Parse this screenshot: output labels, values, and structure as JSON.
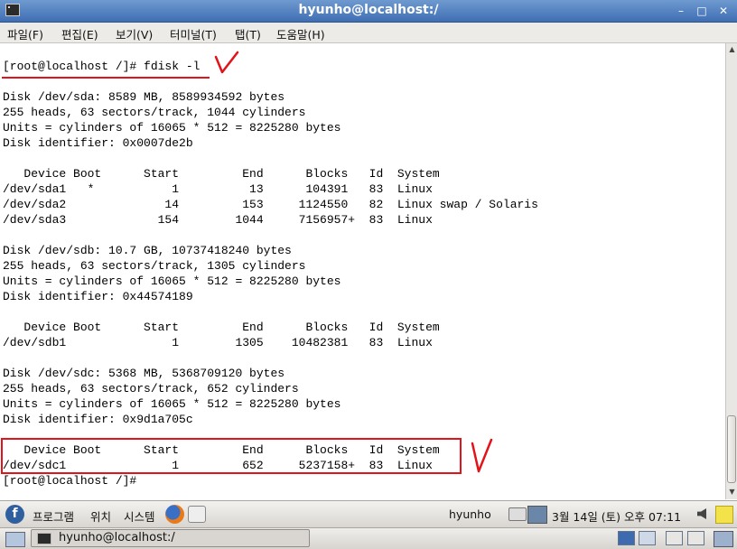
{
  "window": {
    "title": "hyunho@localhost:/",
    "minimize_glyph": "–",
    "maximize_glyph": "□",
    "close_glyph": "✕"
  },
  "menu": [
    "파일(F)",
    "편집(E)",
    "보기(V)",
    "터미널(T)",
    "탭(T)",
    "도움말(H)"
  ],
  "terminal_lines": [
    "[root@localhost /]# fdisk -l",
    "",
    "Disk /dev/sda: 8589 MB, 8589934592 bytes",
    "255 heads, 63 sectors/track, 1044 cylinders",
    "Units = cylinders of 16065 * 512 = 8225280 bytes",
    "Disk identifier: 0x0007de2b",
    "",
    "   Device Boot      Start         End      Blocks   Id  System",
    "/dev/sda1   *           1          13      104391   83  Linux",
    "/dev/sda2              14         153     1124550   82  Linux swap / Solaris",
    "/dev/sda3             154        1044     7156957+  83  Linux",
    "",
    "Disk /dev/sdb: 10.7 GB, 10737418240 bytes",
    "255 heads, 63 sectors/track, 1305 cylinders",
    "Units = cylinders of 16065 * 512 = 8225280 bytes",
    "Disk identifier: 0x44574189",
    "",
    "   Device Boot      Start         End      Blocks   Id  System",
    "/dev/sdb1               1        1305    10482381   83  Linux",
    "",
    "Disk /dev/sdc: 5368 MB, 5368709120 bytes",
    "255 heads, 63 sectors/track, 652 cylinders",
    "Units = cylinders of 16065 * 512 = 8225280 bytes",
    "Disk identifier: 0x9d1a705c",
    "",
    "   Device Boot      Start         End      Blocks   Id  System",
    "/dev/sdc1               1         652     5237158+  83  Linux",
    "[root@localhost /]# "
  ],
  "annotations": {
    "check_mark_1": "V",
    "check_mark_2": "V",
    "color": "#e0141a"
  },
  "scrollbar": {
    "up_glyph": "▲",
    "down_glyph": "▼"
  },
  "panel": {
    "menus": [
      "프로그램",
      "위치",
      "시스템"
    ],
    "user": "hyunho",
    "clock": "3월 14일 (토) 오후 07:11"
  },
  "taskbar": {
    "window_button": "hyunho@localhost:/"
  },
  "colors": {
    "titlebar": "#4f7fc0",
    "highlight": "#e0141a"
  }
}
